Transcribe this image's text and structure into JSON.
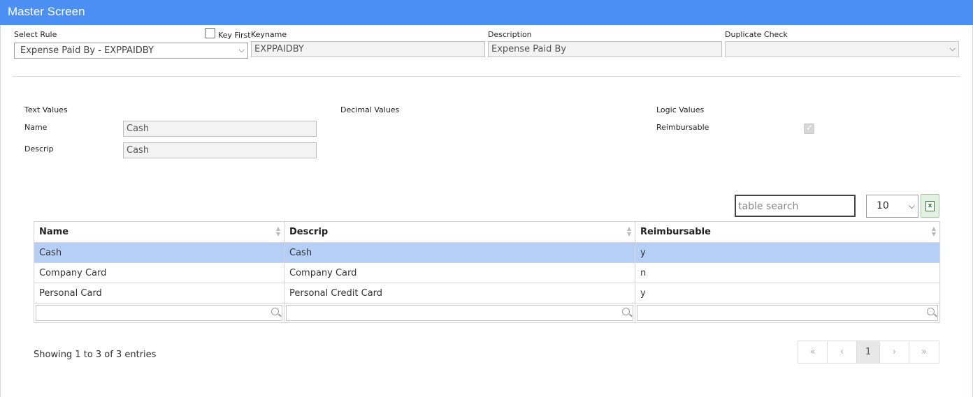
{
  "window": {
    "title": "Master Screen"
  },
  "form": {
    "select_rule_label": "Select Rule",
    "select_rule_value": "Expense Paid By - EXPPAIDBY",
    "key_first_label": "Key First",
    "keyname_label": "Keyname",
    "keyname_value": "EXPPAIDBY",
    "description_label": "Description",
    "description_value": "Expense Paid By",
    "duplicate_check_label": "Duplicate Check",
    "duplicate_check_value": ""
  },
  "values": {
    "text_values_label": "Text Values",
    "decimal_values_label": "Decimal Values",
    "logic_values_label": "Logic Values",
    "name_label": "Name",
    "name_value": "Cash",
    "descrip_label": "Descrip",
    "descrip_value": "Cash",
    "reimbursable_label": "Reimbursable",
    "reimbursable_checked": true
  },
  "table": {
    "search_placeholder": "table search",
    "page_size": "10",
    "columns": [
      "Name",
      "Descrip",
      "Reimbursable"
    ],
    "rows": [
      [
        "Cash",
        "Cash",
        "y"
      ],
      [
        "Company Card",
        "Company Card",
        "n"
      ],
      [
        "Personal Card",
        "Personal Credit Card",
        "y"
      ]
    ],
    "selected_row": 0,
    "info": "Showing 1 to 3 of 3 entries"
  },
  "pager": {
    "first": "«",
    "prev": "‹",
    "current": "1",
    "next": "›",
    "last": "»"
  },
  "colors": {
    "titlebar": "#4b8ff3",
    "selected_row": "#b5cff7"
  }
}
